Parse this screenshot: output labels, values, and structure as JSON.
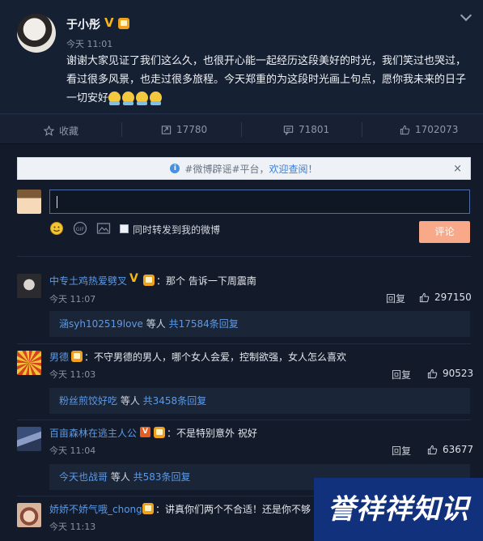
{
  "post": {
    "username": "于小彤",
    "time": "今天 11:01",
    "text": "谢谢大家见证了我们这么久，也很开心能一起经历这段美好的时光，我们笑过也哭过，看过很多风景，也走过很多旅程。今天郑重的为这段时光画上句点，愿你我未来的日子一切安好",
    "emoji_icons": [
      "hug-emoji-icon",
      "hug-emoji-icon",
      "hug-emoji-icon",
      "hug-emoji-icon"
    ]
  },
  "actions": {
    "favorite": "收藏",
    "repost": "17780",
    "comment": "71801",
    "like": "1702073"
  },
  "notice": {
    "prefix": "#微博辟谣#平台，",
    "link": "欢迎查阅！",
    "close": "×"
  },
  "composer": {
    "repost_label": "同时转发到我的微博",
    "submit": "评论"
  },
  "comments": [
    {
      "name": "中专土鸡热爱劈叉",
      "text": "：那个 告诉一下周震南",
      "time": "今天 11:07",
      "reply": "回复",
      "likes": "297150",
      "thread_who": "涵syh102519love",
      "thread_mid": " 等人 ",
      "thread_count": "共17584条回复"
    },
    {
      "name": "男德",
      "text": "：不守男德的男人，哪个女人会爱，控制欲强，女人怎么喜欢",
      "time": "今天 11:03",
      "reply": "回复",
      "likes": "90523",
      "thread_who": "粉丝煎饺好吃",
      "thread_mid": " 等人 ",
      "thread_count": "共3458条回复"
    },
    {
      "name": "百亩森林在逃主人公",
      "text": "：不是特别意外 祝好",
      "time": "今天 11:04",
      "reply": "回复",
      "likes": "63677",
      "thread_who": "今天也战哥",
      "thread_mid": " 等人 ",
      "thread_count": "共583条回复"
    },
    {
      "name": "娇娇不娇气哦_chong",
      "text": "：讲真你们两个不合适！还是你不够",
      "time": "今天 11:13"
    }
  ],
  "watermark": "誉祥祥知识",
  "colors": {
    "background": "#131a29",
    "link": "#5b9ae8",
    "submit": "#f7a98a",
    "vip_badge": "#f0a21e"
  }
}
